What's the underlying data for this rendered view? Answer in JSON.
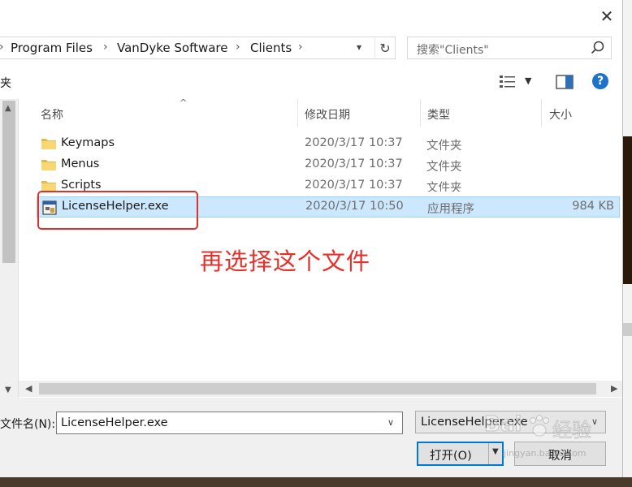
{
  "breadcrumb": [
    "Program Files",
    "VanDyke Software",
    "Clients"
  ],
  "search": {
    "placeholder": "搜索\"Clients\""
  },
  "toolbar": {
    "left_text": "夹"
  },
  "columns": {
    "name": "名称",
    "date": "修改日期",
    "type": "类型",
    "size": "大小"
  },
  "files": [
    {
      "name": "Keymaps",
      "date": "2020/3/17 10:37",
      "type": "文件夹",
      "size": "",
      "kind": "folder",
      "selected": false
    },
    {
      "name": "Menus",
      "date": "2020/3/17 10:37",
      "type": "文件夹",
      "size": "",
      "kind": "folder",
      "selected": false
    },
    {
      "name": "Scripts",
      "date": "2020/3/17 10:37",
      "type": "文件夹",
      "size": "",
      "kind": "folder",
      "selected": false
    },
    {
      "name": "LicenseHelper.exe",
      "date": "2020/3/17 10:50",
      "type": "应用程序",
      "size": "984 KB",
      "kind": "exe",
      "selected": true
    }
  ],
  "annotation": {
    "text": "再选择这个文件",
    "color": "#e63029"
  },
  "bottom": {
    "filename_label": "文件名(N):",
    "filename_value": "LicenseHelper.exe",
    "filetype_value": "LicenseHelper.exe",
    "open_label": "打开(O)",
    "cancel_label": "取消"
  },
  "watermark": {
    "brand": "Bai",
    "brand2": "经验",
    "url": "jingyan.baidu.com"
  },
  "colors": {
    "accent": "#0078d7",
    "selection": "#cce8ff",
    "help": "#1e73c8"
  }
}
